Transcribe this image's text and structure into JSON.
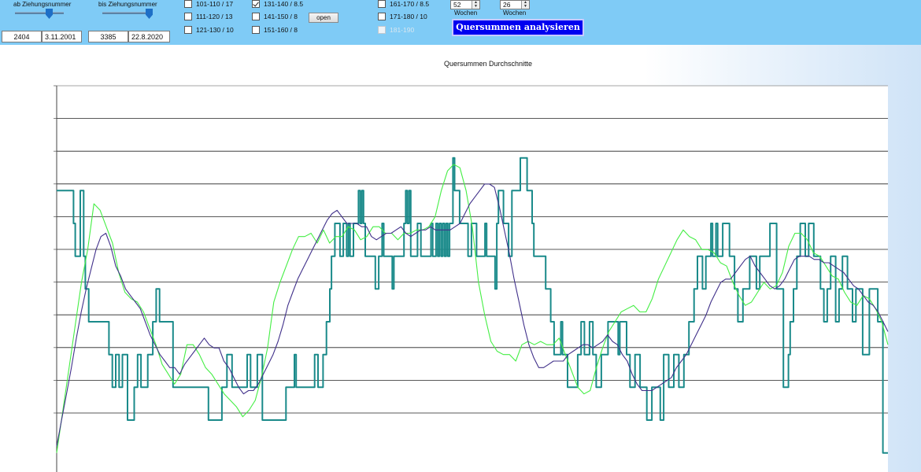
{
  "toolbar": {
    "from_label": "ab Ziehungsnummer",
    "to_label": "bis Ziehungsnummer",
    "from_number": "2404",
    "from_date": "3.11.2001",
    "to_number": "3385",
    "to_date": "22.8.2020",
    "ranges": [
      {
        "label": "101-110 / 17",
        "checked": false,
        "enabled": true
      },
      {
        "label": "111-120 / 13",
        "checked": false,
        "enabled": true
      },
      {
        "label": "121-130 / 10",
        "checked": false,
        "enabled": true
      },
      {
        "label": "131-140 / 8.5",
        "checked": true,
        "enabled": true
      },
      {
        "label": "141-150 / 8",
        "checked": false,
        "enabled": true
      },
      {
        "label": "151-160 / 8",
        "checked": false,
        "enabled": true
      },
      {
        "label": "161-170 / 8.5",
        "checked": false,
        "enabled": true
      },
      {
        "label": "171-180 / 10",
        "checked": false,
        "enabled": true
      },
      {
        "label": "181-190",
        "checked": false,
        "enabled": false
      }
    ],
    "open_label": "open",
    "weeks1_value": "52",
    "weeks1_label": "Wochen",
    "weeks2_value": "26",
    "weeks2_label": "Wochen",
    "analyze_label": "Quersummen analysieren"
  },
  "chart_data": {
    "type": "line",
    "title": "Quersummen Durchschnitte",
    "grid": true,
    "series": [
      {
        "color": "#1a8a8a",
        "style": "step",
        "values": [
          8,
          8,
          8,
          8,
          8,
          8,
          8,
          8,
          8,
          8,
          7,
          6,
          6,
          6,
          8,
          8,
          6,
          5,
          5,
          4,
          4,
          4,
          4,
          4,
          4,
          4,
          4,
          4,
          4,
          4,
          4,
          3,
          3,
          2,
          2,
          3,
          3,
          2,
          2,
          3,
          3,
          3,
          1,
          1,
          1,
          1,
          2,
          2,
          3,
          3,
          2,
          2,
          2,
          2,
          3,
          3,
          3,
          4,
          4,
          5,
          5,
          4,
          4,
          4,
          4,
          4,
          4,
          4,
          4,
          2,
          2,
          2,
          2,
          2,
          2,
          2,
          2,
          2,
          2,
          2,
          2,
          2,
          2,
          2,
          2,
          2,
          2,
          2,
          2,
          2,
          1,
          1,
          1,
          1,
          1,
          1,
          1,
          1,
          2,
          2,
          2,
          3,
          3,
          3,
          2,
          2,
          2,
          2,
          2,
          2,
          2,
          2,
          2,
          3,
          3,
          2,
          2,
          2,
          2,
          3,
          3,
          3,
          1,
          1,
          1,
          1,
          1,
          1,
          1,
          1,
          1,
          1,
          1,
          1,
          1,
          1,
          2,
          2,
          2,
          2,
          2,
          3,
          2,
          2,
          2,
          2,
          2,
          2,
          2,
          2,
          2,
          2,
          2,
          3,
          3,
          2,
          2,
          2,
          3,
          3,
          4,
          4,
          5,
          6,
          6,
          7,
          7,
          7,
          6,
          6,
          7,
          7,
          6,
          7,
          6,
          6,
          7,
          7,
          7,
          8,
          7,
          8,
          7,
          6,
          6,
          6,
          6,
          6,
          6,
          5,
          5,
          6,
          6,
          7,
          6,
          6,
          6,
          6,
          6,
          5,
          6,
          6,
          6,
          6,
          6,
          6,
          7,
          8,
          7,
          8,
          6,
          6,
          6,
          6,
          7,
          7,
          6,
          6,
          6,
          6,
          6,
          6,
          7,
          6,
          6,
          7,
          6,
          7,
          6,
          7,
          6,
          7,
          6,
          7,
          7,
          9,
          8,
          8,
          8,
          7,
          7,
          7,
          7,
          7,
          6,
          6,
          7,
          7,
          7,
          6,
          6,
          6,
          6,
          6,
          7,
          6,
          6,
          6,
          6,
          6,
          5,
          7,
          8,
          8,
          8,
          7,
          7,
          7,
          6,
          6,
          8,
          8,
          8,
          8,
          8,
          9,
          9,
          9,
          9,
          8,
          8,
          8,
          7,
          6,
          6,
          6,
          6,
          6,
          6,
          6,
          5,
          5,
          5,
          4,
          4,
          3,
          3,
          3,
          3,
          4,
          3,
          3,
          3,
          2,
          2,
          2,
          2,
          2,
          2,
          3,
          3,
          4,
          4,
          3,
          3,
          3,
          4,
          4,
          3,
          3,
          2,
          2,
          2,
          3,
          3,
          3,
          3,
          4,
          4,
          4,
          4,
          4,
          4,
          3,
          4,
          4,
          4,
          4,
          3,
          3,
          2,
          2,
          2,
          3,
          3,
          3,
          2,
          2,
          2,
          2,
          1,
          1,
          1,
          2,
          2,
          2,
          2,
          2,
          1,
          1,
          3,
          3,
          3,
          2,
          2,
          2,
          3,
          3,
          3,
          2,
          2,
          2,
          3,
          3,
          3,
          4,
          4,
          4,
          5,
          5,
          6,
          6,
          6,
          5,
          5,
          6,
          6,
          6,
          7,
          6,
          6,
          7,
          6,
          6,
          6,
          7,
          7,
          7,
          7,
          6,
          6,
          6,
          5,
          5,
          4,
          4,
          4,
          5,
          5,
          5,
          5,
          6,
          6,
          6,
          6,
          5,
          5,
          6,
          6,
          6,
          6,
          6,
          6,
          7,
          7,
          7,
          7,
          5,
          5,
          5,
          5,
          2,
          2,
          2,
          3,
          4,
          4,
          5,
          5,
          6,
          6,
          7,
          7,
          7,
          6,
          6,
          7,
          7,
          7,
          6,
          6,
          6,
          6,
          5,
          5,
          4,
          4,
          5,
          5,
          6,
          6,
          6,
          4,
          4,
          5,
          5,
          6,
          6,
          6,
          5,
          5,
          5,
          4,
          4,
          5,
          5,
          5,
          5,
          3,
          3,
          3,
          3,
          5,
          5,
          5,
          5,
          5,
          4,
          4,
          4,
          0,
          0,
          0
        ]
      },
      {
        "color": "#44ee44",
        "values": [
          0,
          1.3,
          2.6,
          3.9,
          5.2,
          6.2,
          7.6,
          7.4,
          6.9,
          6.4,
          5.5,
          4.9,
          4.7,
          4.6,
          4.3,
          3.8,
          3.3,
          2.7,
          2.4,
          2.1,
          2.4,
          3.3,
          3.3,
          3.0,
          2.6,
          2.4,
          2.1,
          1.8,
          1.6,
          1.4,
          1.1,
          1.3,
          1.6,
          2.3,
          3.2,
          4.6,
          5.2,
          5.7,
          6.2,
          6.6,
          6.6,
          6.7,
          6.4,
          6.8,
          6.4,
          6.6,
          6.6,
          6.9,
          6.8,
          6.5,
          6.6,
          6.9,
          6.9,
          6.7,
          6.7,
          6.5,
          6.7,
          6.7,
          6.8,
          6.8,
          6.9,
          7.2,
          8.0,
          8.6,
          8.8,
          8.7,
          8.0,
          6.9,
          5.2,
          4.2,
          3.4,
          3.1,
          3.0,
          3.0,
          2.8,
          3.3,
          3.4,
          3.3,
          3.4,
          3.3,
          3.3,
          3.5,
          3.0,
          2.5,
          2.0,
          1.8,
          1.9,
          2.6,
          3.2,
          3.7,
          4.0,
          4.3,
          4.4,
          4.5,
          4.3,
          4.3,
          4.7,
          5.3,
          5.7,
          6.1,
          6.5,
          6.8,
          6.6,
          6.5,
          6.2,
          6.2,
          6.1,
          5.8,
          5.7,
          5.2,
          4.8,
          4.5,
          4.6,
          4.9,
          5.2,
          5.0,
          5.1,
          5.5,
          6.3,
          6.7,
          6.7,
          6.5,
          6.1,
          6.0,
          5.7,
          5.4,
          5.3,
          4.9,
          4.6,
          4.5,
          4.8,
          4.7,
          4.4,
          4.0,
          3.3
        ]
      },
      {
        "color": "#40308a",
        "values": [
          0.2,
          1.0,
          1.8,
          2.6,
          3.5,
          4.3,
          5.0,
          5.6,
          6.2,
          6.6,
          6.7,
          6.3,
          5.7,
          5.4,
          5.0,
          4.8,
          4.6,
          4.4,
          4.0,
          3.6,
          3.3,
          3.0,
          2.8,
          2.6,
          2.6,
          2.4,
          2.7,
          2.9,
          3.1,
          3.3,
          3.5,
          3.3,
          3.2,
          3.2,
          2.8,
          2.6,
          2.3,
          2.0,
          1.8,
          1.9,
          1.9,
          2.1,
          2.4,
          2.7,
          3.0,
          3.4,
          3.9,
          4.5,
          4.9,
          5.3,
          5.6,
          5.9,
          6.2,
          6.5,
          6.8,
          7.1,
          7.3,
          7.4,
          7.2,
          7.0,
          7.0,
          7.0,
          6.9,
          6.9,
          6.6,
          6.5,
          6.6,
          6.7,
          6.7,
          6.8,
          6.9,
          6.7,
          6.6,
          6.7,
          6.8,
          6.8,
          6.9,
          6.8,
          6.8,
          6.8,
          6.8,
          6.9,
          7.0,
          7.3,
          7.6,
          7.8,
          8.0,
          8.2,
          8.2,
          8.1,
          7.5,
          6.8,
          6.1,
          5.3,
          4.6,
          3.9,
          3.3,
          2.9,
          2.6,
          2.6,
          2.7,
          2.8,
          2.8,
          2.8,
          3.0,
          3.1,
          3.2,
          3.3,
          3.3,
          3.2,
          3.3,
          3.4,
          3.6,
          3.4,
          3.3,
          3.0,
          2.8,
          2.4,
          2.1,
          1.9,
          1.9,
          1.9,
          2.0,
          2.1,
          2.2,
          2.3,
          2.6,
          2.8,
          3.0,
          3.3,
          3.6,
          3.9,
          4.2,
          4.6,
          4.9,
          5.2,
          5.3,
          5.3,
          5.5,
          5.7,
          5.9,
          6.0,
          5.7,
          5.5,
          5.3,
          5.1,
          5.0,
          5.1,
          5.3,
          5.6,
          5.9,
          6.0,
          6.0,
          6.0,
          5.9,
          5.9,
          5.8,
          5.8,
          5.7,
          5.6,
          5.5,
          5.3,
          5.1,
          5.0,
          4.8,
          4.6,
          4.5,
          4.3,
          4.0,
          3.7
        ]
      }
    ]
  }
}
